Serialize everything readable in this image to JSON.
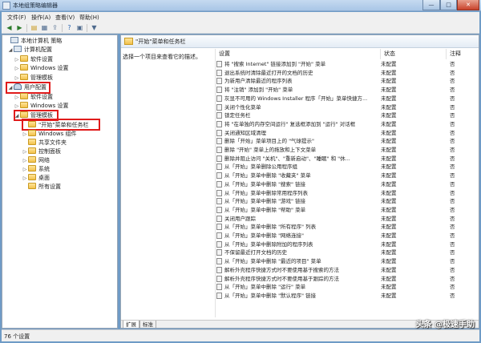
{
  "window": {
    "title": "本地组策略编辑器",
    "min": "—",
    "max": "□",
    "close": "✕"
  },
  "menu": [
    "文件(F)",
    "操作(A)",
    "查看(V)",
    "帮助(H)"
  ],
  "toolbar": [
    "back-icon",
    "forward-icon",
    "folder-up-icon",
    "properties-icon",
    "export-icon",
    "help-icon",
    "view-icon",
    "filter-icon"
  ],
  "tree": {
    "root": "本地计算机 策略",
    "computer_config": "计算机配置",
    "cc_software": "软件设置",
    "cc_windows": "Windows 设置",
    "cc_admin": "管理模板",
    "user_config": "用户配置",
    "uc_software": "软件设置",
    "uc_windows": "Windows 设置",
    "uc_admin": "管理模板",
    "start_menu": "\"开始\"菜单和任务栏",
    "win_components": "Windows 组件",
    "shared_folders": "共享文件夹",
    "control_panel": "控制面板",
    "network": "网络",
    "system": "系统",
    "desktop": "桌面",
    "all_settings": "所有设置"
  },
  "right": {
    "header": "\"开始\"菜单和任务栏",
    "description": "选择一个项目来查看它的描述。",
    "col_setting": "设置",
    "col_state": "状态",
    "col_comment": "注释",
    "rows": [
      {
        "name": "将 \"搜索 Internet\" 链接添加到 \"开始\" 菜单",
        "state": "未配置",
        "comment": "否"
      },
      {
        "name": "退出系统时清除最近打开的文档的历史",
        "state": "未配置",
        "comment": "否"
      },
      {
        "name": "为新用户清除最近的程序列表",
        "state": "未配置",
        "comment": "否"
      },
      {
        "name": "将 \"注销\" 添加到 \"开始\" 菜单",
        "state": "未配置",
        "comment": "否"
      },
      {
        "name": "灰显不可用的 Windows Installer 程序「开始」菜单快捷方...",
        "state": "未配置",
        "comment": "否"
      },
      {
        "name": "关闭个性化菜单",
        "state": "未配置",
        "comment": "否"
      },
      {
        "name": "锁定任务栏",
        "state": "未配置",
        "comment": "否"
      },
      {
        "name": "将 \"在单独的内存空间运行\" 复选框添加到 \"运行\" 对话框",
        "state": "未配置",
        "comment": "否"
      },
      {
        "name": "关闭通知区域清理",
        "state": "未配置",
        "comment": "否"
      },
      {
        "name": "删除「开始」菜单项目上的 \"气球提示\"",
        "state": "未配置",
        "comment": "否"
      },
      {
        "name": "删除 \"开始\" 菜单上的拖放和上下文菜单",
        "state": "未配置",
        "comment": "否"
      },
      {
        "name": "删除并阻止访问 \"关机\"、\"重新启动\"、\"睡眠\" 和 \"休...",
        "state": "未配置",
        "comment": "否"
      },
      {
        "name": "从「开始」菜单删除公用程序组",
        "state": "未配置",
        "comment": "否"
      },
      {
        "name": "从「开始」菜单中删除 \"收藏夹\" 菜单",
        "state": "未配置",
        "comment": "否"
      },
      {
        "name": "从「开始」菜单中删除 \"搜索\" 链接",
        "state": "未配置",
        "comment": "否"
      },
      {
        "name": "从「开始」菜单中删除常用程序列表",
        "state": "未配置",
        "comment": "否"
      },
      {
        "name": "从「开始」菜单中删除 \"游戏\" 链接",
        "state": "未配置",
        "comment": "否"
      },
      {
        "name": "从「开始」菜单中删除 \"帮助\" 菜单",
        "state": "未配置",
        "comment": "否"
      },
      {
        "name": "关闭用户跟踪",
        "state": "未配置",
        "comment": "否"
      },
      {
        "name": "从「开始」菜单中删除 \"所有程序\" 列表",
        "state": "未配置",
        "comment": "否"
      },
      {
        "name": "从「开始」菜单中删除 \"网络连接\"",
        "state": "未配置",
        "comment": "否"
      },
      {
        "name": "从「开始」菜单中删除附加的程序列表",
        "state": "未配置",
        "comment": "否"
      },
      {
        "name": "不保留最近打开文档的历史",
        "state": "未配置",
        "comment": "否"
      },
      {
        "name": "从「开始」菜单中删除 \"最近的项目\" 菜单",
        "state": "未配置",
        "comment": "否"
      },
      {
        "name": "解析外壳程序快捷方式时不要使用基于搜索的方法",
        "state": "未配置",
        "comment": "否"
      },
      {
        "name": "解析外壳程序快捷方式时不要使用基于跟踪的方法",
        "state": "未配置",
        "comment": "否"
      },
      {
        "name": "从「开始」菜单中删除 \"运行\" 菜单",
        "state": "未配置",
        "comment": "否"
      },
      {
        "name": "从「开始」菜单中删除 \"默认程序\" 链接",
        "state": "未配置",
        "comment": "否"
      }
    ],
    "tab_extended": "扩展",
    "tab_standard": "标准"
  },
  "status": "76 个设置",
  "watermark": "头条 @极速手助"
}
